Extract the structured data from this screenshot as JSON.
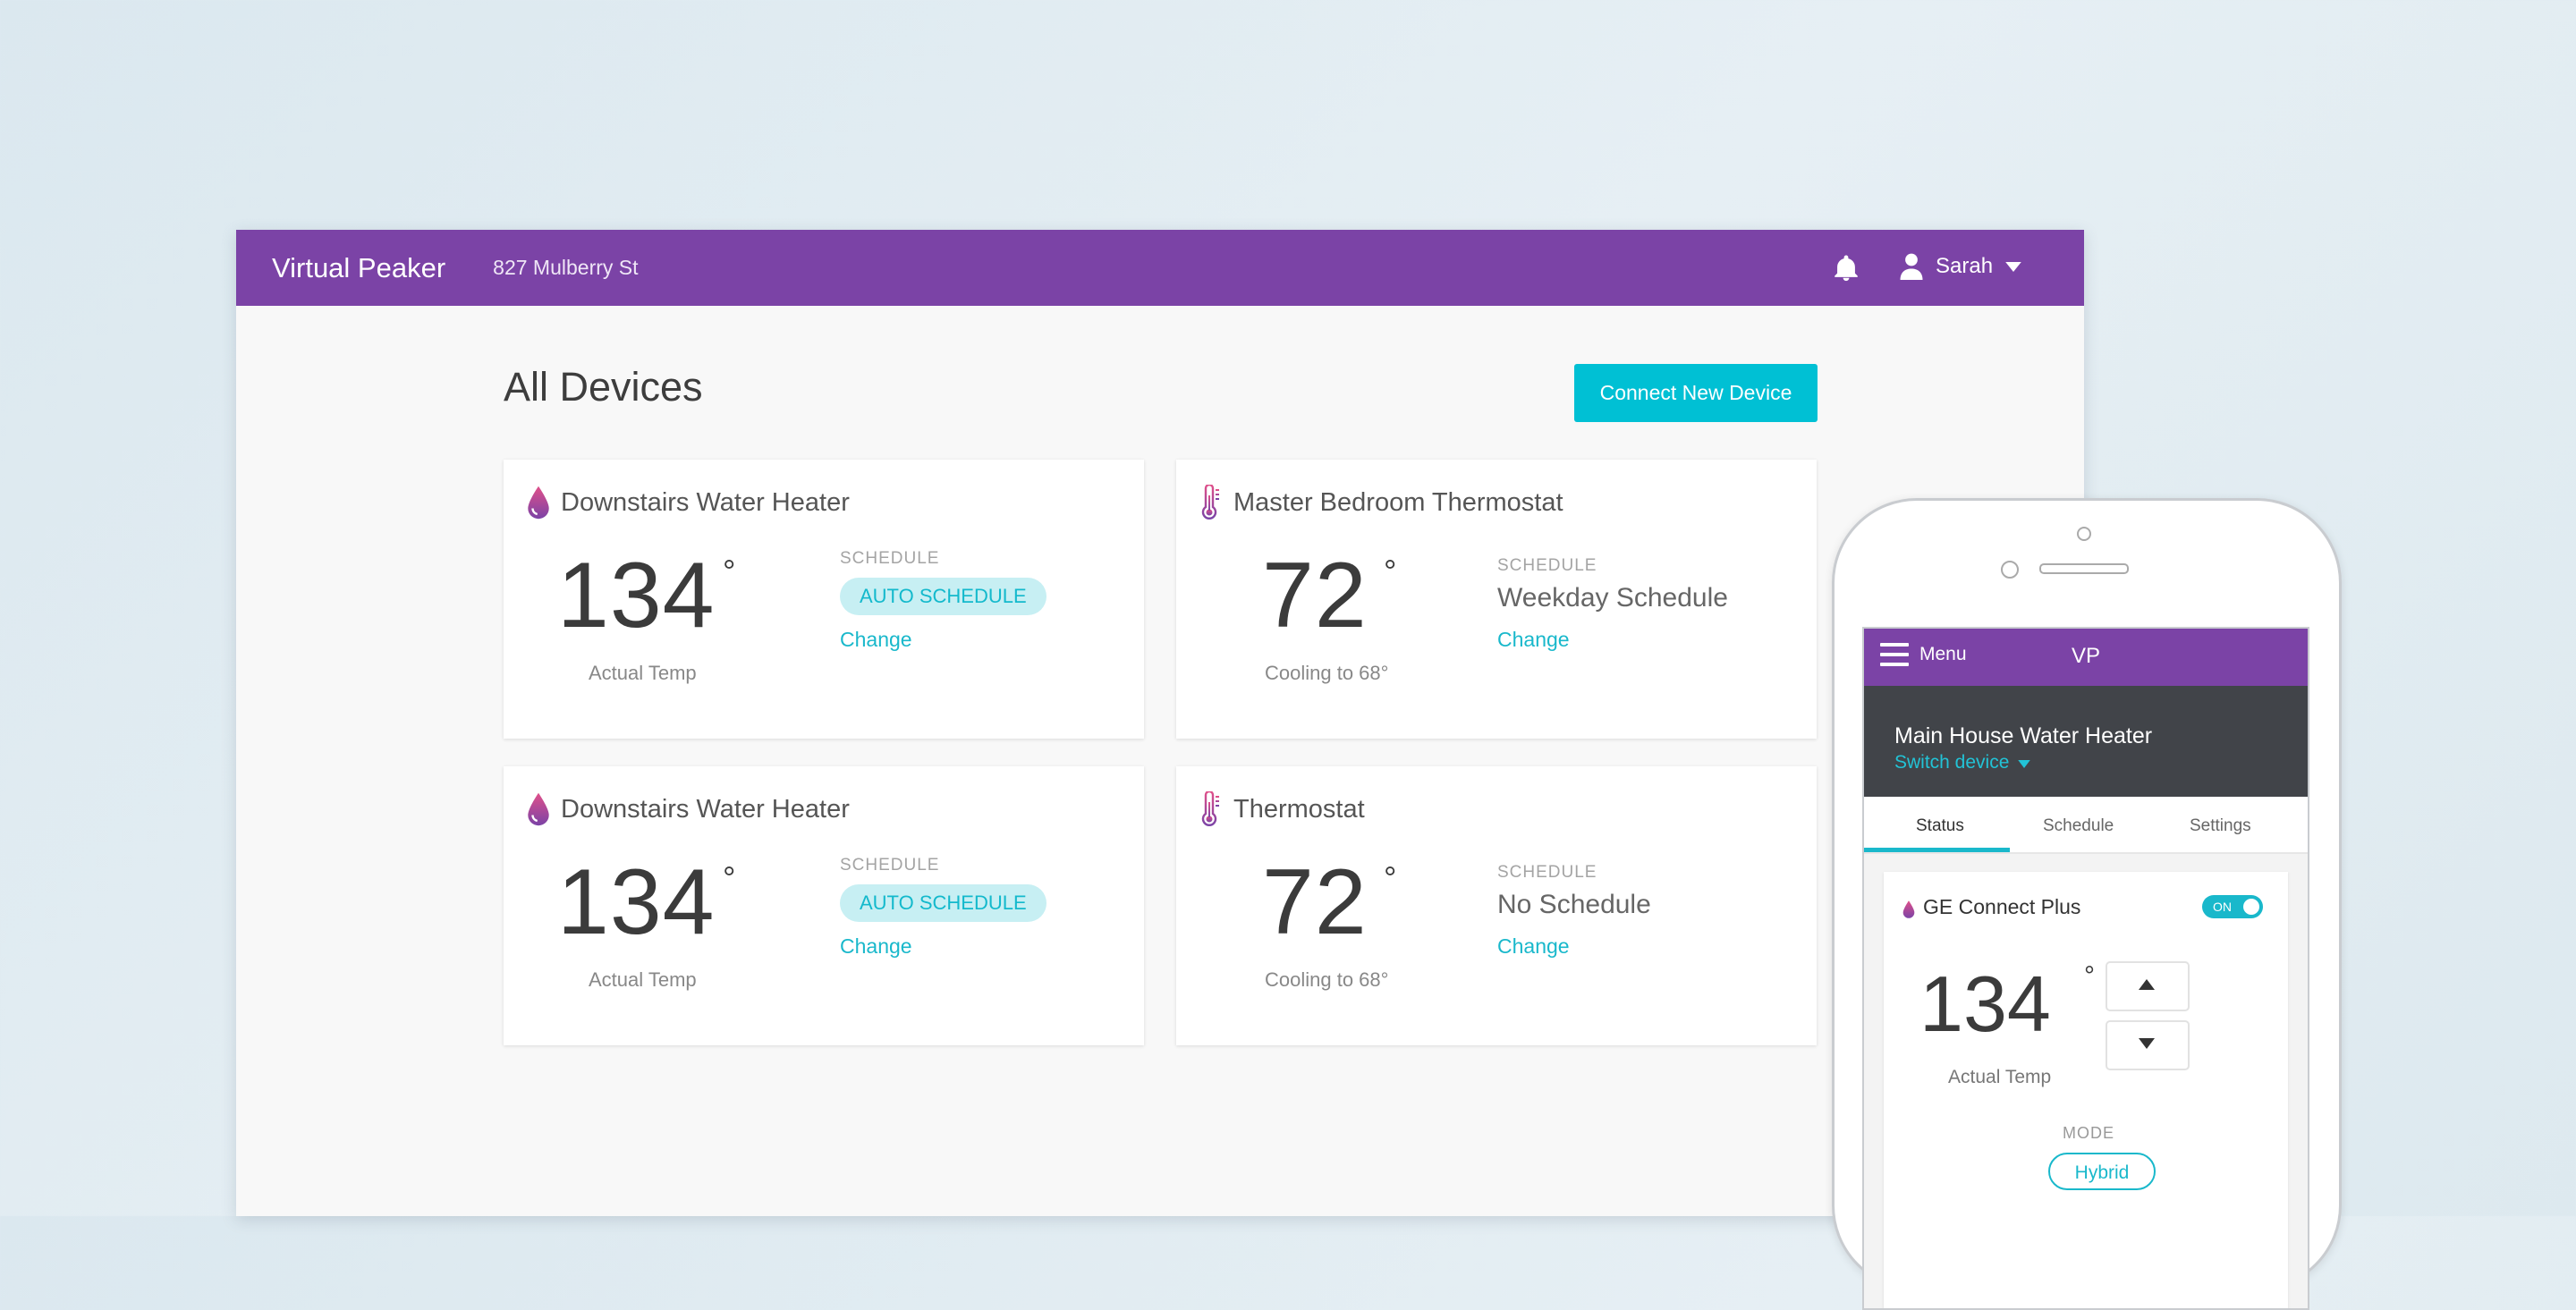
{
  "header": {
    "brand": "Virtual Peaker",
    "address": "827 Mulberry St",
    "user_name": "Sarah",
    "accent_color": "#7b43a6"
  },
  "main": {
    "title": "All Devices",
    "connect_button": "Connect New Device",
    "cards": [
      {
        "name": "Downstairs Water Heater",
        "icon": "water-drop-icon",
        "temp": "134",
        "temp_label": "Actual Temp",
        "schedule_label": "SCHEDULE",
        "schedule": "AUTO SCHEDULE",
        "change": "Change"
      },
      {
        "name": "Master Bedroom Thermostat",
        "icon": "thermometer-icon",
        "temp": "72",
        "temp_label": "Cooling to 68°",
        "schedule_label": "SCHEDULE",
        "schedule": "Weekday Schedule",
        "change": "Change"
      },
      {
        "name": "Downstairs Water Heater",
        "icon": "water-drop-icon",
        "temp": "134",
        "temp_label": "Actual Temp",
        "schedule_label": "SCHEDULE",
        "schedule": "AUTO SCHEDULE",
        "change": "Change"
      },
      {
        "name": "Thermostat",
        "icon": "thermometer-icon",
        "temp": "72",
        "temp_label": "Cooling to 68°",
        "schedule_label": "SCHEDULE",
        "schedule": "No Schedule",
        "change": "Change"
      }
    ],
    "degree_symbol": "°"
  },
  "mobile": {
    "menu_label": "Menu",
    "logo": "VP",
    "device_name": "Main House Water Heater",
    "switch_device": "Switch device",
    "tabs": [
      "Status",
      "Schedule",
      "Settings"
    ],
    "active_tab": "Status",
    "card": {
      "name": "GE Connect Plus",
      "toggle": "ON",
      "temp": "134",
      "temp_label": "Actual Temp",
      "mode_label": "MODE",
      "mode": "Hybrid"
    }
  }
}
